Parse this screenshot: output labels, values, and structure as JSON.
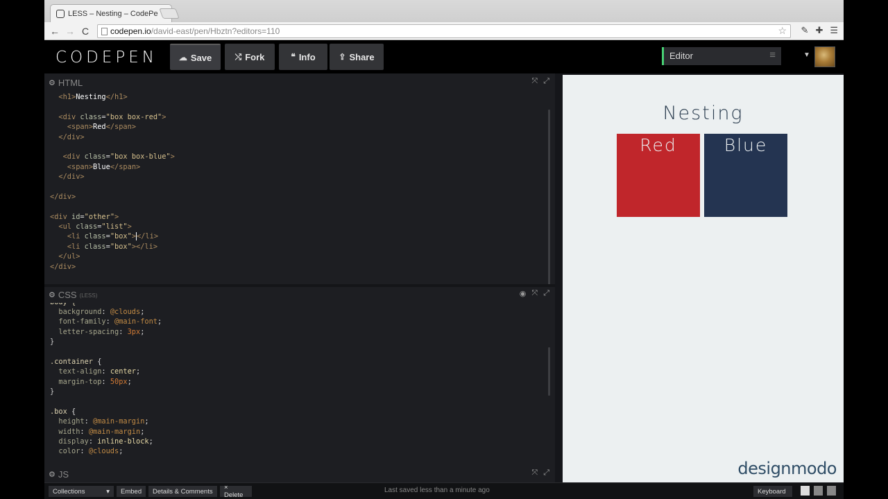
{
  "browser": {
    "tab_title": "LESS – Nesting – CodePen",
    "tab_close": "×",
    "back_icon": "←",
    "forward_icon": "→",
    "reload_icon": "C",
    "url_host": "codepen.io",
    "url_path": "/david-east/pen/Hbztn?editors=110"
  },
  "header": {
    "logo": "CODEPEN",
    "buttons": {
      "save": "Save",
      "fork": "Fork",
      "info": "Info",
      "share": "Share"
    },
    "editor_select": "Editor"
  },
  "html_panel": {
    "title": "HTML"
  },
  "css_panel": {
    "title": "CSS",
    "preprocessor": "(LESS)"
  },
  "js_panel": {
    "title": "JS"
  },
  "html_code": [
    "  <h1>Nesting</h1>",
    "",
    "  <div class=\"box box-red\">",
    "    <span>Red</span>",
    "  </div>",
    "",
    "   <div class=\"box box-blue\">",
    "    <span>Blue</span>",
    "  </div>",
    "",
    "</div>",
    "",
    "<div id=\"other\">",
    "  <ul class=\"list\">",
    "    <li class=\"box\">|</li>",
    "    <li class=\"box\"></li>",
    "  </ul>",
    "</div>"
  ],
  "css_code": [
    "  background: @clouds;",
    "  font-family: @main-font;",
    "  letter-spacing: 3px;",
    "}",
    "",
    ".container {",
    "  text-align: center;",
    "  margin-top: 50px;",
    "}",
    "",
    ".box {",
    "  height: @main-margin;",
    "  width: @main-margin;",
    "  display: inline-block;",
    "  color: @clouds;"
  ],
  "preview": {
    "heading": "Nesting",
    "box_red": "Red",
    "box_blue": "Blue",
    "watermark": "designmodo"
  },
  "footer": {
    "collections": "Collections",
    "embed": "Embed",
    "details": "Details & Comments",
    "delete": "× Delete",
    "saved_status": "Last saved less than a minute ago",
    "keyboard": "Keyboard"
  },
  "colors": {
    "red": "#c0262b",
    "blue": "#243451",
    "preview_bg": "#ecf0f1",
    "accent": "#47cf73"
  }
}
